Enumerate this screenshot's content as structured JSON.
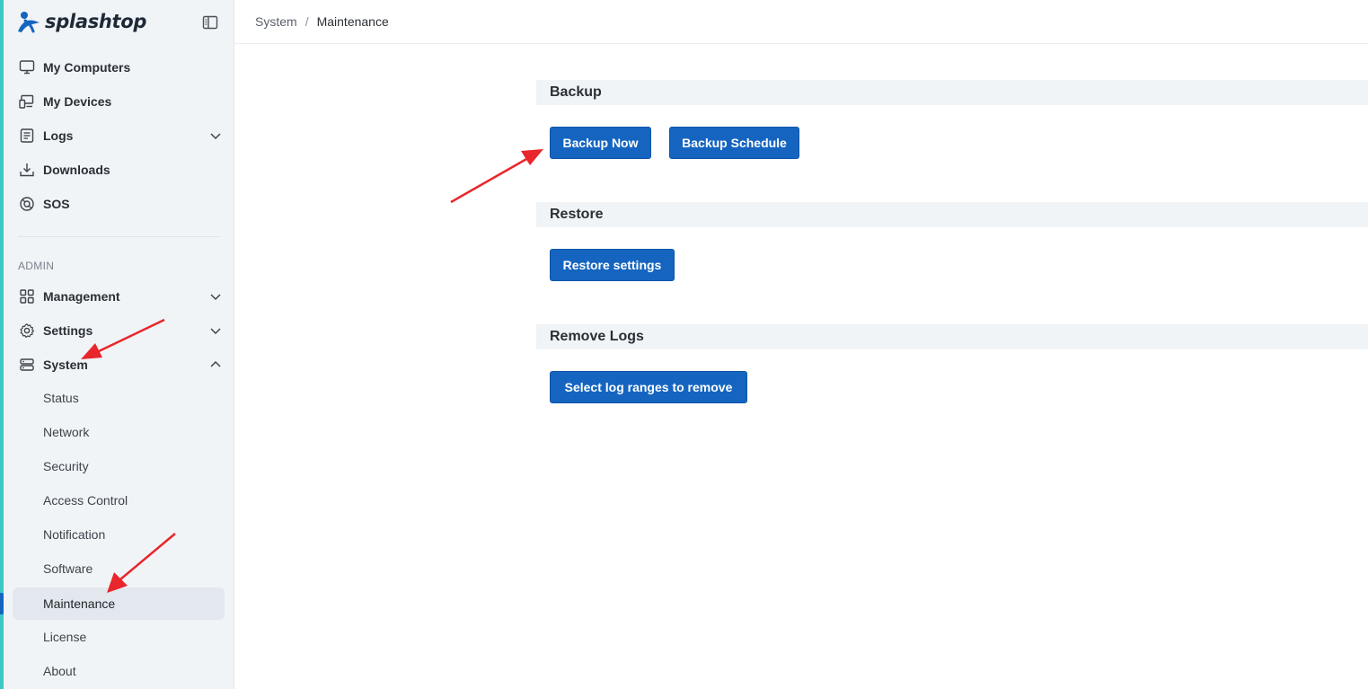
{
  "app": {
    "logo_text": "splashtop",
    "brand_color": "#1565c0"
  },
  "sidebar": {
    "primary": [
      {
        "label": "My Computers",
        "icon": "monitor-icon"
      },
      {
        "label": "My Devices",
        "icon": "devices-icon"
      },
      {
        "label": "Logs",
        "icon": "logs-icon",
        "expandable": true,
        "expanded": false
      },
      {
        "label": "Downloads",
        "icon": "download-icon"
      },
      {
        "label": "SOS",
        "icon": "sos-icon"
      }
    ],
    "admin_label": "ADMIN",
    "admin": [
      {
        "label": "Management",
        "icon": "grid-icon",
        "expandable": true,
        "expanded": false
      },
      {
        "label": "Settings",
        "icon": "gear-icon",
        "expandable": true,
        "expanded": false
      },
      {
        "label": "System",
        "icon": "server-icon",
        "expandable": true,
        "expanded": true
      }
    ],
    "system_items": [
      {
        "label": "Status"
      },
      {
        "label": "Network"
      },
      {
        "label": "Security"
      },
      {
        "label": "Access Control"
      },
      {
        "label": "Notification"
      },
      {
        "label": "Software"
      },
      {
        "label": "Maintenance",
        "active": true
      },
      {
        "label": "License"
      },
      {
        "label": "About"
      }
    ]
  },
  "breadcrumb": {
    "parent": "System",
    "separator": "/",
    "current": "Maintenance"
  },
  "main": {
    "backup": {
      "title": "Backup",
      "backup_now": "Backup Now",
      "backup_schedule": "Backup Schedule"
    },
    "restore": {
      "title": "Restore",
      "restore_settings": "Restore settings"
    },
    "remove_logs": {
      "title": "Remove Logs",
      "select_ranges": "Select log ranges to remove"
    }
  }
}
